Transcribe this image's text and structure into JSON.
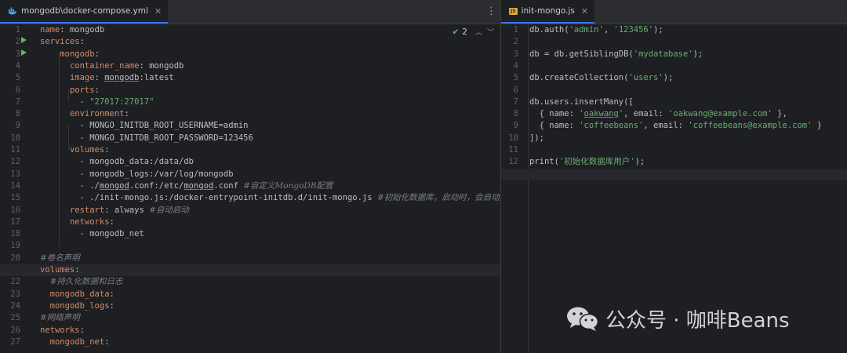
{
  "left_pane": {
    "tab": {
      "label": "mongodb\\docker-compose.yml",
      "icon": "docker-icon",
      "close": "✕"
    },
    "menu_icon": "⋮",
    "inspection": {
      "icon": "check-icon",
      "count": "2"
    },
    "lines": [
      {
        "n": "1"
      },
      {
        "n": "2"
      },
      {
        "n": "3"
      },
      {
        "n": "4"
      },
      {
        "n": "5"
      },
      {
        "n": "6"
      },
      {
        "n": "7"
      },
      {
        "n": "8"
      },
      {
        "n": "9"
      },
      {
        "n": "10"
      },
      {
        "n": "11"
      },
      {
        "n": "12"
      },
      {
        "n": "13"
      },
      {
        "n": "14"
      },
      {
        "n": "15"
      },
      {
        "n": "16"
      },
      {
        "n": "17"
      },
      {
        "n": "18"
      },
      {
        "n": "19"
      },
      {
        "n": "20"
      },
      {
        "n": "21"
      },
      {
        "n": "22"
      },
      {
        "n": "23"
      },
      {
        "n": "24"
      },
      {
        "n": "25"
      },
      {
        "n": "26"
      },
      {
        "n": "27"
      }
    ],
    "code": {
      "l1": {
        "key": "name",
        "value": "mongodb"
      },
      "l2": {
        "key": "services"
      },
      "l3": {
        "key": "mongodb"
      },
      "l4": {
        "key": "container_name",
        "value": "mongodb"
      },
      "l5": {
        "key": "image",
        "value_u": "mongodb",
        "value_rest": ":latest"
      },
      "l6": {
        "key": "ports"
      },
      "l7": {
        "value": "\"27017:27017\""
      },
      "l8": {
        "key": "environment"
      },
      "l9": {
        "value": "MONGO_INITDB_ROOT_USERNAME=admin"
      },
      "l10": {
        "value": "MONGO_INITDB_ROOT_PASSWORD=123456"
      },
      "l11": {
        "key": "volumes"
      },
      "l12": {
        "value": "mongodb_data:/data/db"
      },
      "l13": {
        "value": "mongodb_logs:/var/log/mongodb"
      },
      "l14": {
        "p1": "./",
        "u1": "mongod",
        "p2": ".conf:/etc/",
        "u2": "mongod",
        "p3": ".conf ",
        "comment": "#自定义MongoDB配置"
      },
      "l15": {
        "value": "./init-mongo.js:/docker-entrypoint-initdb.d/init-mongo.js ",
        "comment": "#初始化数据库，启动时，会自动执行这个js文件"
      },
      "l16": {
        "key": "restart",
        "value": "always ",
        "comment": "#自动启动"
      },
      "l17": {
        "key": "networks"
      },
      "l18": {
        "value": "mongodb_net"
      },
      "l20": {
        "comment": "#卷名声明"
      },
      "l21": {
        "key": "volumes"
      },
      "l22": {
        "comment": "#持久化数据和日志"
      },
      "l23": {
        "key": "mongodb_data"
      },
      "l24": {
        "key": "mongodb_logs"
      },
      "l25": {
        "comment": "#网络声明"
      },
      "l26": {
        "key": "networks"
      },
      "l27": {
        "key": "mongodb_net"
      }
    }
  },
  "right_pane": {
    "tab": {
      "label": "init-mongo.js",
      "icon": "js-file-icon",
      "icon_text": "JS",
      "close": "✕"
    },
    "lines": [
      {
        "n": "1"
      },
      {
        "n": "2"
      },
      {
        "n": "3"
      },
      {
        "n": "4"
      },
      {
        "n": "5"
      },
      {
        "n": "6"
      },
      {
        "n": "7"
      },
      {
        "n": "8"
      },
      {
        "n": "9"
      },
      {
        "n": "10"
      },
      {
        "n": "11"
      },
      {
        "n": "12"
      },
      {
        "n": "13"
      }
    ],
    "code": {
      "l1": {
        "a": "db.auth(",
        "s1": "'admin'",
        "b": ", ",
        "s2": "'123456'",
        "c": ");"
      },
      "l3": {
        "a": "db = db.getSiblingDB(",
        "s1": "'mydatabase'",
        "c": ");"
      },
      "l5": {
        "a": "db.createCollection(",
        "s1": "'users'",
        "c": ");"
      },
      "l7": {
        "a": "db.users.insertMany(["
      },
      "l8": {
        "a": "  { name: ",
        "q1": "'",
        "su": "oakwang",
        "q2": "'",
        "b": ", email: ",
        "s2": "'oakwang@example.com'",
        "c": " },"
      },
      "l9": {
        "a": "  { name: ",
        "s1": "'coffeebeans'",
        "b": ", email: ",
        "s2": "'coffeebeans@example.com'",
        "c": " }"
      },
      "l10": {
        "a": "]);"
      },
      "l12": {
        "a": "print(",
        "s1": "'初始化数据库用户'",
        "c": ");"
      }
    }
  },
  "watermark": {
    "icon": "wechat-icon",
    "text": "公众号 · 咖啡Beans"
  }
}
